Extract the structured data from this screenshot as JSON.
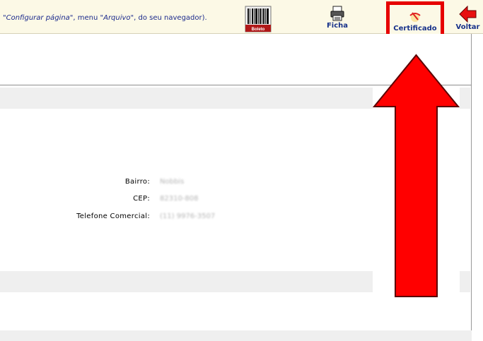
{
  "toolbar": {
    "hint_page_setup": "\"Configurar página\"",
    "hint_middle": ", menu ",
    "hint_file_menu": "\"Arquivo\"",
    "hint_end": ", do seu navegador).",
    "boleto_label": "Boleto",
    "ficha_label": "Ficha",
    "certificado_label": "Certificado",
    "voltar_label": "Voltar"
  },
  "details": {
    "bairro_label": "Bairro:",
    "bairro_value": "Nobbis",
    "cep_label": "CEP:",
    "cep_value": "82310-808",
    "telefone_label": "Telefone Comercial:",
    "telefone_value": "(11) 9976-3507"
  },
  "colors": {
    "toolbar_bg": "#fcf9e6",
    "link_blue": "#16318a",
    "highlight_red": "#e60000"
  }
}
